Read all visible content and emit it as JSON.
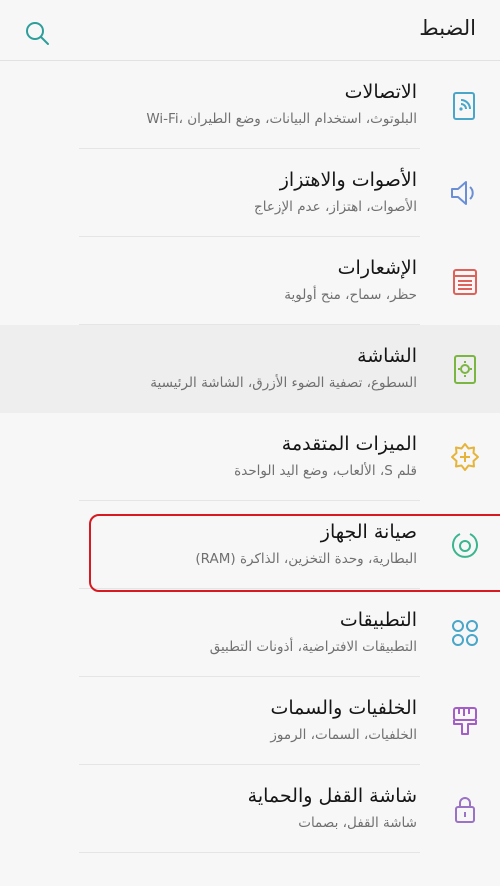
{
  "header": {
    "title": "الضبط",
    "search_icon": "search-icon"
  },
  "accent": "#2e9e9b",
  "highlight_color": "#d71921",
  "items": [
    {
      "label": "الاتصالات",
      "sub": "البلوتوث، استخدام البيانات، وضع الطيران ،Wi-Fi",
      "icon": "connections-icon"
    },
    {
      "label": "الأصوات والاهتزاز",
      "sub": "الأصوات، اهتزاز، عدم الإزعاج",
      "icon": "sound-icon"
    },
    {
      "label": "الإشعارات",
      "sub": "حظر، سماح، منح أولوية",
      "icon": "notifications-icon"
    },
    {
      "label": "الشاشة",
      "sub": "السطوع، تصفية الضوء الأزرق، الشاشة الرئيسية",
      "icon": "display-icon"
    },
    {
      "label": "الميزات المتقدمة",
      "sub": "قلم S، الألعاب، وضع اليد الواحدة",
      "icon": "advanced-features-icon"
    },
    {
      "label": "صيانة الجهاز",
      "sub": "البطارية، وحدة التخزين، الذاكرة (RAM)",
      "icon": "device-maintenance-icon"
    },
    {
      "label": "التطبيقات",
      "sub": "التطبيقات الافتراضية، أذونات التطبيق",
      "icon": "apps-icon"
    },
    {
      "label": "الخلفيات والسمات",
      "sub": "الخلفيات، السمات، الرموز",
      "icon": "wallpapers-themes-icon"
    },
    {
      "label": "شاشة القفل والحماية",
      "sub": "شاشة القفل، بصمات",
      "icon": "lock-screen-icon"
    }
  ]
}
